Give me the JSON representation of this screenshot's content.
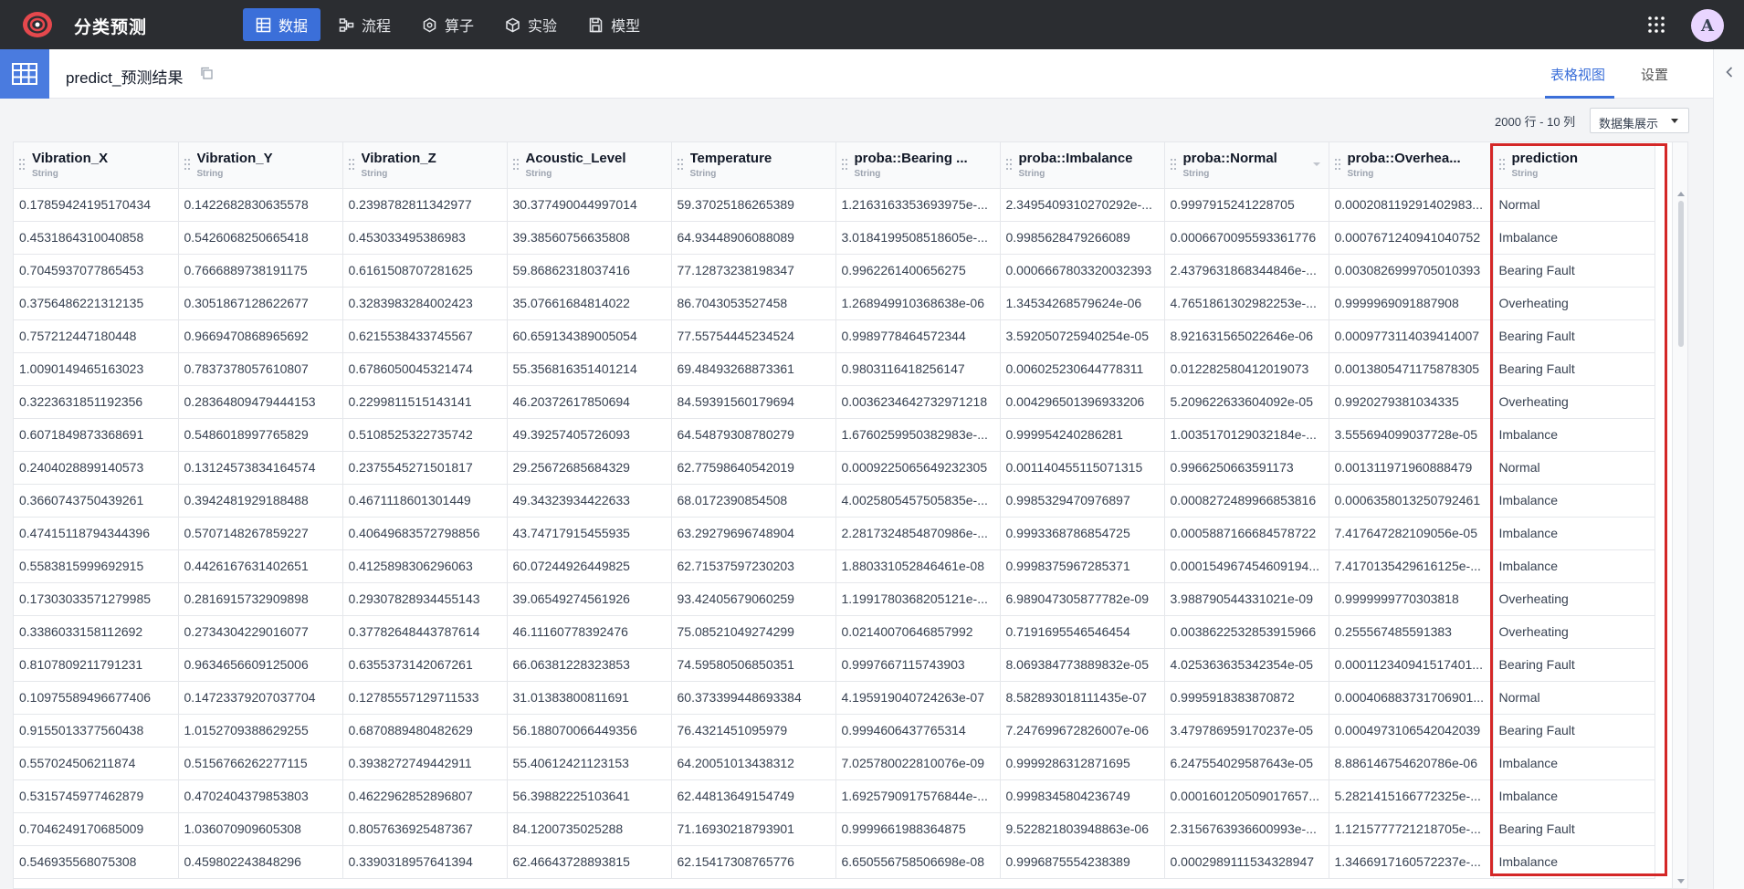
{
  "app": {
    "title": "分类预测"
  },
  "nav": [
    {
      "label": "数据",
      "icon": "table-icon",
      "active": true
    },
    {
      "label": "流程",
      "icon": "flow-icon"
    },
    {
      "label": "算子",
      "icon": "operator-icon"
    },
    {
      "label": "实验",
      "icon": "cube-icon"
    },
    {
      "label": "模型",
      "icon": "model-icon"
    }
  ],
  "user": {
    "avatar": "A"
  },
  "header": {
    "title": "predict_预测结果",
    "tabs": [
      "表格视图",
      "设置"
    ]
  },
  "toolbar": {
    "rows_info": "2000 行 - 10 列",
    "dataset_select": "数据集展示"
  },
  "columns": [
    {
      "name": "Vibration_X",
      "type": "String"
    },
    {
      "name": "Vibration_Y",
      "type": "String"
    },
    {
      "name": "Vibration_Z",
      "type": "String"
    },
    {
      "name": "Acoustic_Level",
      "type": "String"
    },
    {
      "name": "Temperature",
      "type": "String"
    },
    {
      "name": "proba::Bearing ...",
      "type": "String"
    },
    {
      "name": "proba::Imbalance",
      "type": "String"
    },
    {
      "name": "proba::Normal",
      "type": "String"
    },
    {
      "name": "proba::Overhea...",
      "type": "String"
    },
    {
      "name": "prediction",
      "type": "String"
    }
  ],
  "rows": [
    [
      "0.17859424195170434",
      "0.1422682830635578",
      "0.2398782811342977",
      "30.377490044997014",
      "59.37025186265389",
      "1.2163163353693975e-...",
      "2.3495409310270292e-...",
      "0.9997915241228705",
      "0.000208119291402983...",
      "Normal"
    ],
    [
      "0.4531864310040858",
      "0.5426068250665418",
      "0.453033495386983",
      "39.38560756635808",
      "64.93448906088089",
      "3.0184199508518605e-...",
      "0.9985628479266089",
      "0.0006670095593361776",
      "0.0007671240941040752",
      "Imbalance"
    ],
    [
      "0.7045937077865453",
      "0.7666889738191175",
      "0.6161508707281625",
      "59.86862318037416",
      "77.12873238198347",
      "0.9962261400656275",
      "0.0006667803320032393",
      "2.4379631868344846e-...",
      "0.0030826999705010393",
      "Bearing Fault"
    ],
    [
      "0.3756486221312135",
      "0.3051867128622677",
      "0.3283983284002423",
      "35.07661684814022",
      "86.7043053527458",
      "1.268949910368638e-06",
      "1.34534268579624e-06",
      "4.7651861302982253e-...",
      "0.9999969091887908",
      "Overheating"
    ],
    [
      "0.757212447180448",
      "0.9669470868965692",
      "0.6215538433745567",
      "60.659134389005054",
      "77.55754445234524",
      "0.9989778464572344",
      "3.592050725940254e-05",
      "8.921631565022646e-06",
      "0.0009773114039414007",
      "Bearing Fault"
    ],
    [
      "1.0090149465163023",
      "0.7837378057610807",
      "0.6786050045321474",
      "55.356816351401214",
      "69.48493268873361",
      "0.9803116418256147",
      "0.006025230644778311",
      "0.012282580412019073",
      "0.0013805471175878305",
      "Bearing Fault"
    ],
    [
      "0.3223631851192356",
      "0.28364809479444153",
      "0.2299811515143141",
      "46.20372617850694",
      "84.59391560179694",
      "0.0036234642732971218",
      "0.004296501396933206",
      "5.209622633604092e-05",
      "0.9920279381034335",
      "Overheating"
    ],
    [
      "0.6071849873368691",
      "0.5486018997765829",
      "0.5108525322735742",
      "49.39257405726093",
      "64.54879308780279",
      "1.6760259950382983e-...",
      "0.999954240286281",
      "1.0035170129032184e-...",
      "3.555694099037728e-05",
      "Imbalance"
    ],
    [
      "0.2404028899140573",
      "0.13124573834164574",
      "0.2375545271501817",
      "29.25672685684329",
      "62.77598640542019",
      "0.0009225065649232305",
      "0.001140455115071315",
      "0.9966250663591173",
      "0.001311971960888479",
      "Normal"
    ],
    [
      "0.3660743750439261",
      "0.3942481929188488",
      "0.4671118601301449",
      "49.34323934422633",
      "68.0172390854508",
      "4.0025805457505835e-...",
      "0.9985329470976897",
      "0.0008272489966853816",
      "0.0006358013250792461",
      "Imbalance"
    ],
    [
      "0.47415118794344396",
      "0.5707148267859227",
      "0.40649683572798856",
      "43.74717915455935",
      "63.29279696748904",
      "2.2817324854870986e-...",
      "0.9993368786854725",
      "0.0005887166684578722",
      "7.417647282109056e-05",
      "Imbalance"
    ],
    [
      "0.5583815999692915",
      "0.4426167631402651",
      "0.4125898306296063",
      "60.07244926449825",
      "62.71537597230203",
      "1.880331052846461e-08",
      "0.9998375967285371",
      "0.000154967454609194...",
      "7.4170135429616125e-...",
      "Imbalance"
    ],
    [
      "0.17303033571279985",
      "0.2816915732909898",
      "0.29307828934455143",
      "39.06549274561926",
      "93.42405679060259",
      "1.1991780368205121e-...",
      "6.989047305877782e-09",
      "3.988790544331021e-09",
      "0.9999999770303818",
      "Overheating"
    ],
    [
      "0.3386033158112692",
      "0.2734304229016077",
      "0.37782648443787614",
      "46.11160778392476",
      "75.08521049274299",
      "0.02140070646857992",
      "0.7191695546546454",
      "0.0038622532853915966",
      "0.255567485591383",
      "Overheating"
    ],
    [
      "0.8107809211791231",
      "0.9634656609125006",
      "0.6355373142067261",
      "66.06381228323853",
      "74.59580506850351",
      "0.9997667115743903",
      "8.069384773889832e-05",
      "4.025363635342354e-05",
      "0.000112340941517401...",
      "Bearing Fault"
    ],
    [
      "0.10975589496677406",
      "0.14723379207037704",
      "0.12785557129711533",
      "31.01383800811691",
      "60.373399448693384",
      "4.195919040724263e-07",
      "8.582893018111435e-07",
      "0.9995918383870872",
      "0.000406883731706901...",
      "Normal"
    ],
    [
      "0.9155013377560438",
      "1.0152709388629255",
      "0.6870889480482629",
      "56.188070066449356",
      "76.4321451095979",
      "0.9994606437765314",
      "7.247699672826007e-06",
      "3.479786959170237e-05",
      "0.0004973106542042039",
      "Bearing Fault"
    ],
    [
      "0.557024506211874",
      "0.5156766262277115",
      "0.3938272749442911",
      "55.40612421123153",
      "64.20051013438312",
      "7.025780022810076e-09",
      "0.9999286312871695",
      "6.247554029587643e-05",
      "8.886146754620786e-06",
      "Imbalance"
    ],
    [
      "0.5315745977462879",
      "0.4702404379853803",
      "0.4622962852896807",
      "56.39882225103641",
      "62.44813649154749",
      "1.6925790917576844e-...",
      "0.9998345804236749",
      "0.000160120509017657...",
      "5.2821415166772325e-...",
      "Imbalance"
    ],
    [
      "0.7046249170685009",
      "1.036070909605308",
      "0.8057636925487367",
      "84.1200735025288",
      "71.16930218793901",
      "0.9999661988364875",
      "9.522821803948863e-06",
      "2.3156763936600993e-...",
      "1.1215777721218705e-...",
      "Bearing Fault"
    ],
    [
      "0.546935568075308",
      "0.459802243848296",
      "0.3390318957641394",
      "62.46643728893815",
      "62.15417308765776",
      "6.650556758506698e-08",
      "0.9996875554238389",
      "0.0002989111534328947",
      "1.3466917160572237e-...",
      "Imbalance"
    ]
  ]
}
